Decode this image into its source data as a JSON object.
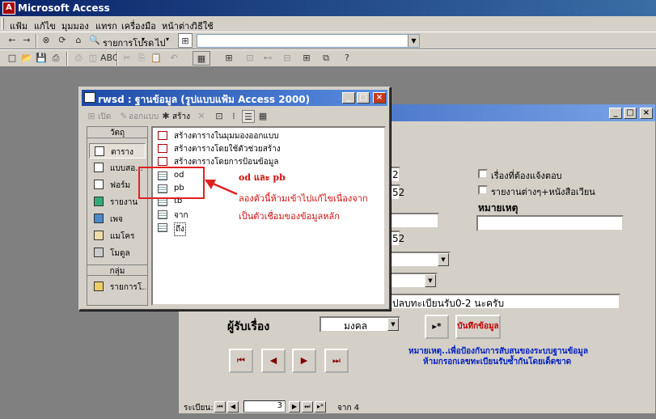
{
  "app": {
    "title": "Microsoft Access",
    "icon": "access-icon"
  },
  "menu": [
    "แฟ้ม",
    "แก้ไข",
    "มุมมอง",
    "แทรก",
    "เครื่องมือ",
    "หน้าต่าง",
    "วิธีใช้"
  ],
  "web_toolbar": {
    "favorites": "รายการโปรด",
    "go": "ไป",
    "address_value": ""
  },
  "db_window": {
    "title": "rwsd : ฐานข้อมูล (รูปแบบแฟ้ม Access 2000)",
    "toolbar": {
      "open": "เปิด",
      "design": "ออกแบบ",
      "new": "สร้าง"
    },
    "objects_header": "วัตถุ",
    "objects": [
      "ตาราง",
      "แบบสอ...",
      "ฟอร์ม",
      "รายงาน",
      "เพจ",
      "แมโคร",
      "โมดูล"
    ],
    "groups_header": "กลุ่ม",
    "groups": [
      "รายการโ..."
    ],
    "items": [
      "สร้างตารางในมุมมองออกแบบ",
      "สร้างตารางโดยใช้ตัวช่วยสร้าง",
      "สร้างตารางโดยการป้อนข้อมูล",
      "od",
      "pb",
      "tb",
      "จาก",
      "ถึง"
    ]
  },
  "annotation": {
    "label": "od และ pb",
    "line1": "ลองตัวนี้ห้ามเข้าไปแก้ไขเนื่องจาก",
    "line2": "เป็นตัวเชื่อมของข้อมูลหลัก",
    "color": "#d01010"
  },
  "form": {
    "field_values": [
      "2",
      "52",
      "",
      "52"
    ],
    "checkbox1": "เรื่องที่ต้องแจ้งตอบ",
    "checkbox2": "รายงานต่างๆ+หนังสือเวียน",
    "remarks_label": "หมายเหตุ",
    "remarks_value": "",
    "note_text": "ปลบทะเบียนรับ0-2 นะครับ",
    "receiver_label": "ผู้รับเรื่อง",
    "receiver_value": "มงคล",
    "save_button": "บันทึกข้อมูล",
    "new_record_button": "▸*",
    "warning_line1": "หมายเหตุ..เพื่อป้องกันการสับสนของระบบฐานข้อมูล",
    "warning_line2": "ห้ามกรอกเลขทะเบียนรับซ้ำกันโดยเด็ดขาด",
    "nav_buttons": [
      "first-record",
      "previous-record",
      "next-record",
      "last-record"
    ],
    "record_label": "ระเบียน:",
    "record_current": "3",
    "record_of": "จาก 4"
  }
}
